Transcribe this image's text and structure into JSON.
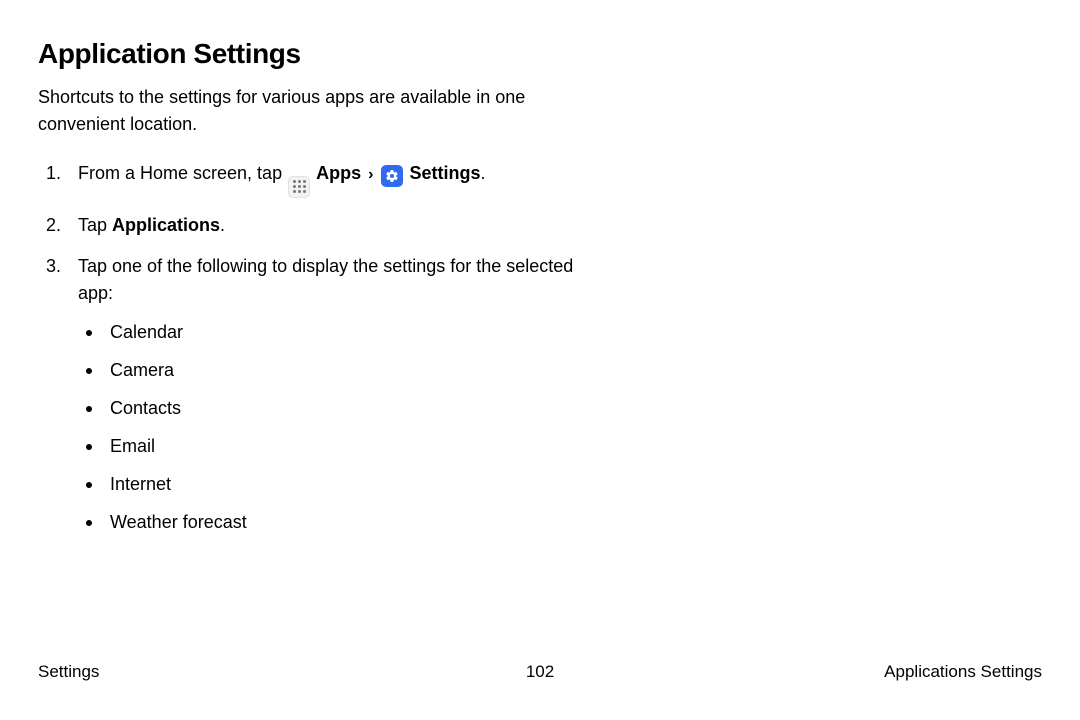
{
  "title": "Application Settings",
  "subtitle": "Shortcuts to the settings for various apps are available in one convenient location.",
  "step1": {
    "prefix": "From a Home screen, tap ",
    "apps_label": "Apps",
    "settings_label": "Settings",
    "suffix": "."
  },
  "step2": {
    "prefix": "Tap ",
    "bold": "Applications",
    "suffix": "."
  },
  "step3": {
    "text": "Tap one of the following to display the settings for the selected app:",
    "items": [
      "Calendar",
      "Camera",
      "Contacts",
      "Email",
      "Internet",
      "Weather forecast"
    ]
  },
  "footer": {
    "left": "Settings",
    "center": "102",
    "right": "Applications Settings"
  }
}
